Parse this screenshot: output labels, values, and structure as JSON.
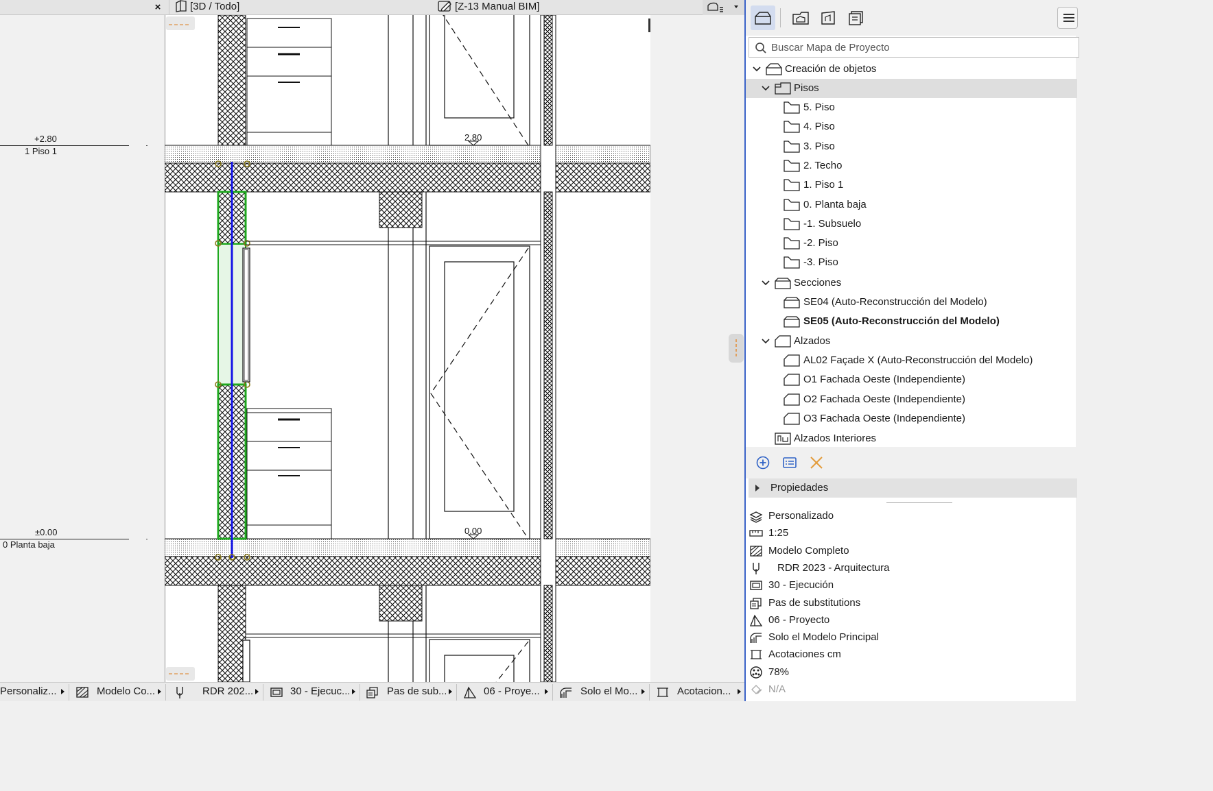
{
  "tabs": {
    "close_glyph": "×",
    "tab_3d": "[3D / Todo]",
    "tab_active": "[Z-13 Manual BIM]"
  },
  "levels": {
    "upper_value": "+2.80",
    "upper_name": "1 Piso 1",
    "lower_value": "±0.00",
    "lower_name": "0 Planta baja"
  },
  "drawing": {
    "upper_marker": "2.80",
    "lower_marker": "0.00"
  },
  "search": {
    "placeholder": "Buscar Mapa de Proyecto"
  },
  "tree": {
    "root": "Creación de objetos",
    "pisos_label": "Pisos",
    "pisos": [
      "5. Piso",
      "4. Piso",
      "3. Piso",
      "2. Techo",
      "1. Piso 1",
      "0. Planta baja",
      "-1. Subsuelo",
      "-2. Piso",
      "-3. Piso"
    ],
    "secciones_label": "Secciones",
    "secciones": [
      "SE04 (Auto-Reconstrucción del Modelo)",
      "SE05 (Auto-Reconstrucción del Modelo)"
    ],
    "alzados_label": "Alzados",
    "alzados": [
      "AL02 Façade X (Auto-Reconstrucción del Modelo)",
      "O1 Fachada Oeste (Independiente)",
      "O2 Fachada Oeste (Independiente)",
      "O3 Fachada Oeste (Independiente)"
    ],
    "alzados_interiores_label": "Alzados Interiores"
  },
  "properties": {
    "header": "Propiedades"
  },
  "quick_options": [
    {
      "icon": "layer-combination-icon",
      "label": "Personalizado"
    },
    {
      "icon": "scale-icon",
      "label": "1:25"
    },
    {
      "icon": "structure-display-icon",
      "label": "Modelo Completo"
    },
    {
      "icon": "pen-set-icon",
      "label": "RDR 2023 - Arquitectura"
    },
    {
      "icon": "model-view-options-icon",
      "label": "30 - Ejecución"
    },
    {
      "icon": "graphic-override-icon",
      "label": "Pas de substitutions"
    },
    {
      "icon": "renovation-filter-icon",
      "label": "06 - Proyecto"
    },
    {
      "icon": "xref-display-icon",
      "label": "Solo el Modelo Principal"
    },
    {
      "icon": "dimension-style-icon",
      "label": "Acotaciones cm"
    },
    {
      "icon": "zoom-icon",
      "label": "78%"
    },
    {
      "icon": "partial-structure-icon",
      "label": "N/A"
    }
  ],
  "statusbar": [
    {
      "icon": "",
      "label": "Personaliz..."
    },
    {
      "icon": "structure-display-icon",
      "label": "Modelo Co..."
    },
    {
      "icon": "pen-set-icon",
      "label": "RDR 202..."
    },
    {
      "icon": "model-view-options-icon",
      "label": "30 - Ejecuc..."
    },
    {
      "icon": "graphic-override-icon",
      "label": "Pas de sub..."
    },
    {
      "icon": "renovation-filter-icon",
      "label": "06 - Proye..."
    },
    {
      "icon": "xref-display-icon",
      "label": "Solo el Mo..."
    },
    {
      "icon": "dimension-style-icon",
      "label": "Acotacion..."
    }
  ],
  "colors": {
    "panel_accent": "#3b63c8",
    "selected_wall_green": "#1fa81f",
    "reference_line_blue": "#1414e6",
    "hotspot_olive": "#8a7a1a"
  }
}
